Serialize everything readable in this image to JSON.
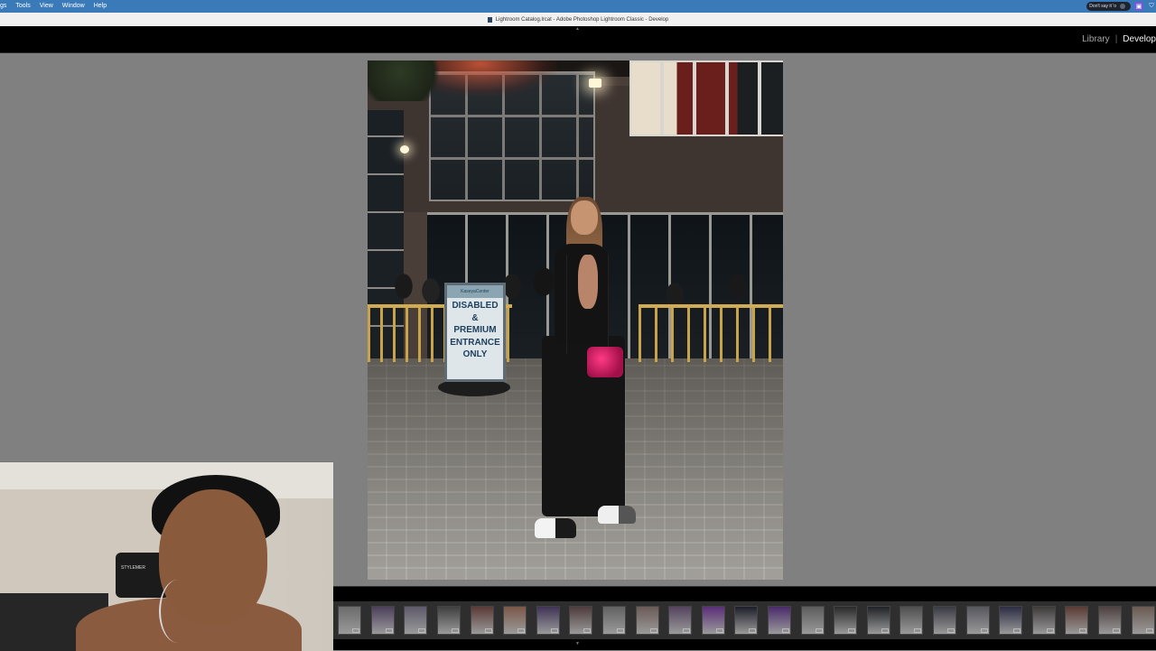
{
  "menubar": {
    "items": [
      "gs",
      "Tools",
      "View",
      "Window",
      "Help"
    ],
    "now_playing": "Don't say it 'o",
    "accent": "#3a7ab8"
  },
  "titlebar": {
    "title": "Lightroom Catalog.lrcat - Adobe Photoshop Lightroom Classic - Develop"
  },
  "modules": {
    "library": "Library",
    "separator": "|",
    "develop": "Develop",
    "active": "Develop"
  },
  "photo": {
    "sign": {
      "header": "KaseyaCenter",
      "lines": [
        "DISABLED",
        "&",
        "PREMIUM",
        "ENTRANCE",
        "ONLY"
      ]
    }
  },
  "filmstrip": {
    "thumbnails": [
      {
        "color": "#6b6b6b"
      },
      {
        "color": "#4b3f5a"
      },
      {
        "color": "#5e5a6a"
      },
      {
        "color": "#3f3f3f"
      },
      {
        "color": "#5a3a36"
      },
      {
        "color": "#7a5848"
      },
      {
        "color": "#3f3355"
      },
      {
        "color": "#4e3b3b"
      },
      {
        "color": "#626262"
      },
      {
        "color": "#6b5a56"
      },
      {
        "color": "#54445e"
      },
      {
        "color": "#5a2e78"
      },
      {
        "color": "#1e1e2a"
      },
      {
        "color": "#4a2a6a"
      },
      {
        "color": "#5c5c5c"
      },
      {
        "color": "#2a2a2a"
      },
      {
        "color": "#1f2226"
      },
      {
        "color": "#4f4f4f"
      },
      {
        "color": "#3a3a44"
      },
      {
        "color": "#56565e"
      },
      {
        "color": "#2c2c44"
      },
      {
        "color": "#3e3a3a"
      },
      {
        "color": "#5a3a34"
      },
      {
        "color": "#4e4040"
      },
      {
        "color": "#6a5a52"
      }
    ]
  },
  "webcam": {
    "chair_label": "STYLEMER"
  },
  "icons": {
    "menu_right": [
      "now-playing-icon",
      "screen-record-icon",
      "shield-icon"
    ],
    "collapse_top": "triangle-up-icon",
    "collapse_bottom": "triangle-down-icon"
  }
}
